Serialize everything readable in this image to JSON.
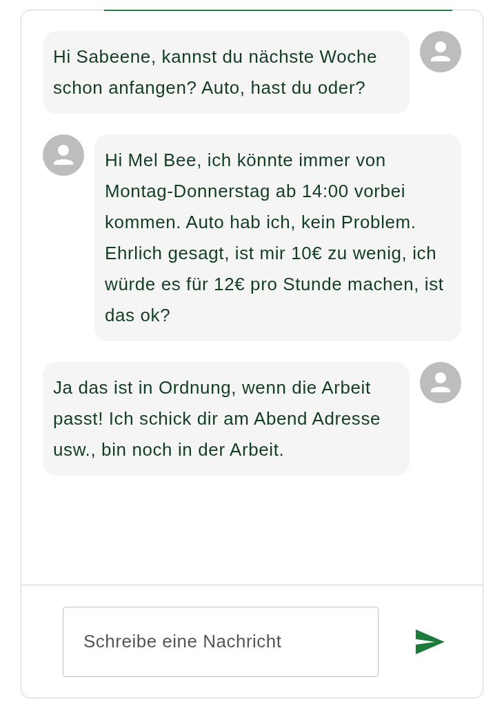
{
  "messages": [
    {
      "kind": "outgoing",
      "text": "Hi Sabeene, kannst du nächste Woche schon anfangen? Auto, hast du oder?"
    },
    {
      "kind": "incoming",
      "text": "Hi Mel Bee, ich könnte immer von Montag-Donnerstag ab 14:00 vorbei kommen. Auto hab ich, kein Problem. Ehrlich gesagt, ist mir 10€ zu wenig, ich würde es für 12€ pro Stunde machen, ist das ok?"
    },
    {
      "kind": "outgoing",
      "text": "Ja das ist in Ordnung, wenn die Arbeit passt! Ich schick dir am Abend Adresse usw., bin noch in der Arbeit."
    }
  ],
  "composer": {
    "placeholder": "Schreibe eine Nachricht"
  }
}
